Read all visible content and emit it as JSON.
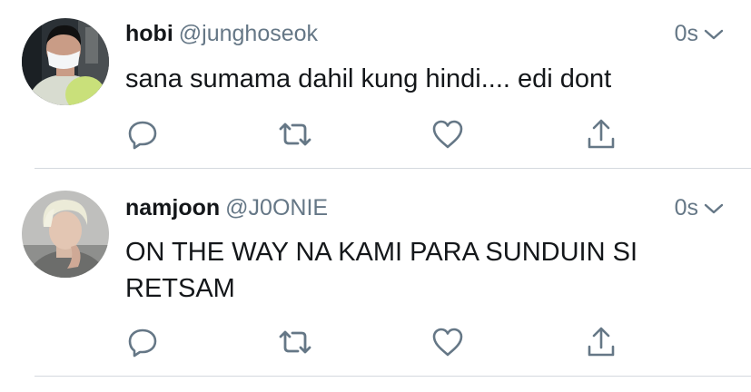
{
  "tweets": [
    {
      "name": "hobi",
      "handle": "@junghoseok",
      "time": "0s",
      "text": "sana sumama dahil kung hindi.... edi dont",
      "avatar_icon": "person-mask-avatar"
    },
    {
      "name": "namjoon",
      "handle": "@J0ONIE",
      "time": "0s",
      "text": "ON THE WAY NA KAMI PARA SUNDUIN SI RETSAM",
      "avatar_icon": "person-blonde-avatar"
    }
  ],
  "action_icons": [
    "reply-icon",
    "retweet-icon",
    "like-icon",
    "share-icon"
  ],
  "colors": {
    "text": "#14171a",
    "secondary": "#657786",
    "icon": "#657786",
    "divider": "#d4d9de"
  }
}
